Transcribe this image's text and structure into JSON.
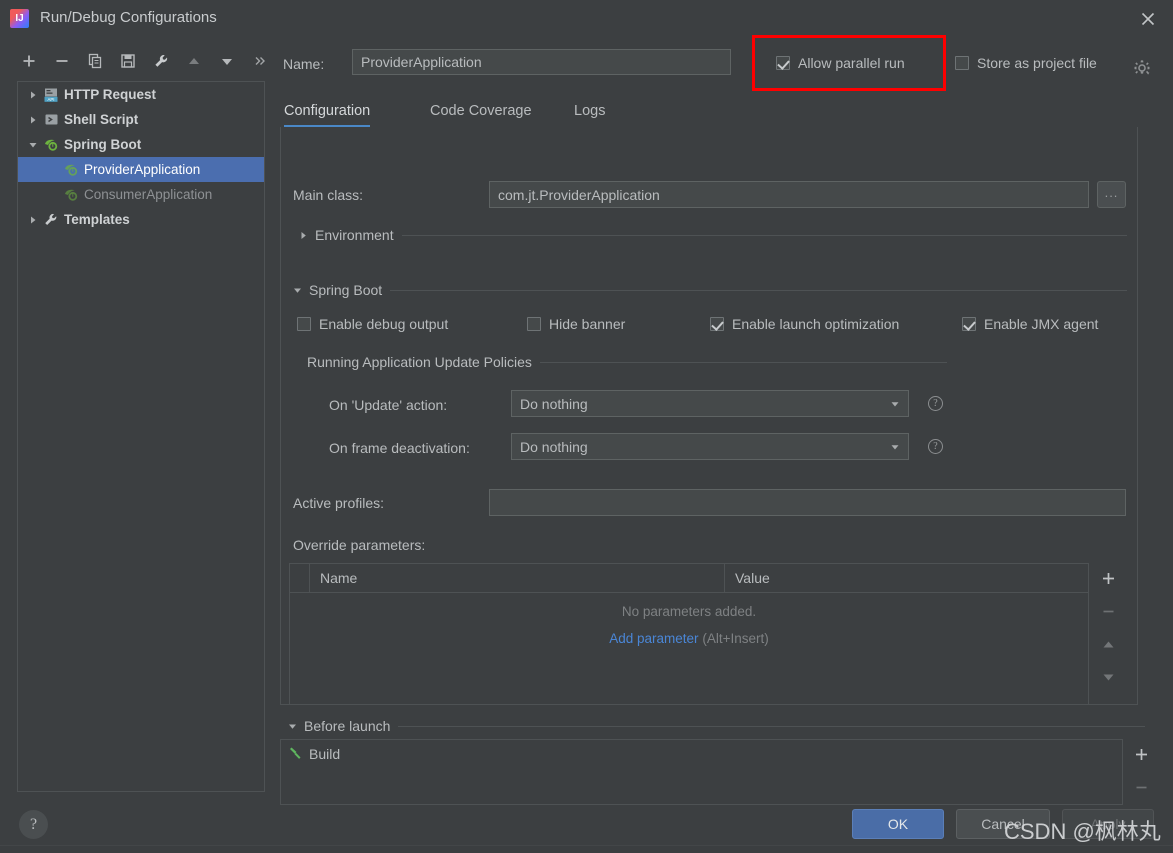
{
  "window": {
    "title": "Run/Debug Configurations",
    "app_icon": "intellij-idea-icon",
    "close_icon": "close-icon"
  },
  "toolbar": {
    "buttons": [
      {
        "name": "add-configuration-button",
        "icon": "plus-icon",
        "label": "+"
      },
      {
        "name": "remove-configuration-button",
        "icon": "minus-icon",
        "label": "−"
      },
      {
        "name": "copy-configuration-button",
        "icon": "copy-icon",
        "label": "Copy"
      },
      {
        "name": "save-configuration-button",
        "icon": "save-icon",
        "label": "Save"
      },
      {
        "name": "edit-templates-button",
        "icon": "wrench-icon",
        "label": "Edit Templates"
      },
      {
        "name": "move-up-button",
        "icon": "arrow-up-icon",
        "label": "Move Up"
      },
      {
        "name": "move-down-button",
        "icon": "arrow-down-icon",
        "label": "Move Down"
      },
      {
        "name": "more-actions-button",
        "icon": "chevrons-right-icon",
        "label": "»"
      }
    ]
  },
  "tree": {
    "items": [
      {
        "label": "HTTP Request",
        "icon": "http-request-icon",
        "expanded": false,
        "level": 0,
        "style": "bold"
      },
      {
        "label": "Shell Script",
        "icon": "shell-script-icon",
        "expanded": false,
        "level": 0,
        "style": "bold"
      },
      {
        "label": "Spring Boot",
        "icon": "spring-boot-icon",
        "expanded": true,
        "level": 0,
        "style": "bold"
      },
      {
        "label": "ProviderApplication",
        "icon": "spring-boot-icon",
        "level": 1,
        "style": "plain",
        "selected": true
      },
      {
        "label": "ConsumerApplication",
        "icon": "spring-boot-icon",
        "level": 1,
        "style": "dim",
        "selected": false
      },
      {
        "label": "Templates",
        "icon": "wrench-icon",
        "expanded": false,
        "level": 0,
        "style": "bold"
      }
    ]
  },
  "header": {
    "name_label": "Name:",
    "name_value": "ProviderApplication",
    "name_placeholder": "Name",
    "allow_parallel_run": {
      "label": "Allow parallel run",
      "checked": true,
      "highlighted": true
    },
    "store_as_project_file": {
      "label": "Store as project file",
      "checked": false
    },
    "gear_icon": "gear-icon"
  },
  "tabs": [
    {
      "label": "Configuration",
      "active": true
    },
    {
      "label": "Code Coverage",
      "active": false
    },
    {
      "label": "Logs",
      "active": false
    }
  ],
  "configuration": {
    "main_class": {
      "label": "Main class:",
      "value": "com.jt.ProviderApplication",
      "browse_label": "..."
    },
    "environment_section": {
      "title": "Environment",
      "expanded": false
    },
    "spring_boot_section": {
      "title": "Spring Boot",
      "expanded": true
    },
    "spring_boot_checkboxes": [
      {
        "label": "Enable debug output",
        "checked": false
      },
      {
        "label": "Hide banner",
        "checked": false
      },
      {
        "label": "Enable launch optimization",
        "checked": true
      },
      {
        "label": "Enable JMX agent",
        "checked": true
      }
    ],
    "update_policies": {
      "title": "Running Application Update Policies",
      "rows": [
        {
          "label": "On 'Update' action:",
          "value": "Do nothing",
          "help": "?"
        },
        {
          "label": "On frame deactivation:",
          "value": "Do nothing",
          "help": "?"
        }
      ]
    },
    "active_profiles": {
      "label": "Active profiles:",
      "value": "",
      "placeholder": ""
    },
    "override_parameters": {
      "label": "Override parameters:",
      "columns": [
        "Name",
        "Value"
      ],
      "rows": [],
      "empty_text": "No parameters added.",
      "add_link": "Add parameter",
      "add_hint": "(Alt+Insert)",
      "side_buttons": [
        {
          "name": "add-parameter-button",
          "icon": "plus-icon"
        },
        {
          "name": "remove-parameter-button",
          "icon": "minus-icon"
        },
        {
          "name": "move-parameter-up-button",
          "icon": "arrow-up-icon"
        },
        {
          "name": "move-parameter-down-button",
          "icon": "arrow-down-icon"
        }
      ]
    },
    "before_launch": {
      "title": "Before launch",
      "expanded": true,
      "tasks": [
        {
          "label": "Build",
          "icon": "build-hammer-icon"
        }
      ],
      "side_buttons": [
        {
          "name": "add-task-button",
          "icon": "plus-icon"
        },
        {
          "name": "remove-task-button",
          "icon": "minus-icon"
        }
      ]
    }
  },
  "footer": {
    "help_label": "?",
    "ok_label": "OK",
    "cancel_label": "Cancel",
    "apply_label": "Apply",
    "apply_enabled": false
  },
  "watermark": "CSDN @枫林丸",
  "colors": {
    "background": "#3c3f41",
    "panel_border": "#4e5254",
    "text": "#b9bcbe",
    "selection": "#4b6eaf",
    "accent_link": "#4a86d6",
    "tab_underline": "#4a88c7",
    "highlight_box": "#ff0000",
    "ok_button": "#4a6da7"
  }
}
